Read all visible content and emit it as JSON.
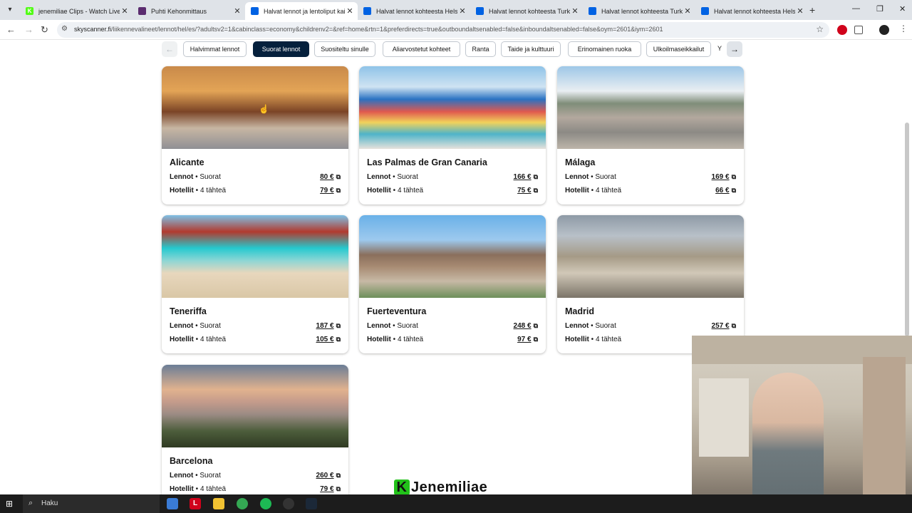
{
  "browser": {
    "tabs": [
      {
        "title": "jenemiliae Clips - Watch Live on",
        "fav_color": "#53fc18",
        "fav_text": "K"
      },
      {
        "title": "Puhti Kehonmittaus",
        "fav_color": "#5b2c6f",
        "fav_text": ""
      },
      {
        "title": "Halvat lennot ja lentoliput kaikk",
        "fav_color": "#0062e3",
        "fav_text": ""
      },
      {
        "title": "Halvat lennot kohteesta Helsinki",
        "fav_color": "#0062e3",
        "fav_text": ""
      },
      {
        "title": "Halvat lennot kohteesta Turku",
        "fav_color": "#0062e3",
        "fav_text": ""
      },
      {
        "title": "Halvat lennot kohteesta Turku",
        "fav_color": "#0062e3",
        "fav_text": ""
      },
      {
        "title": "Halvat lennot kohteesta Helsinki",
        "fav_color": "#0062e3",
        "fav_text": ""
      }
    ],
    "active_tab": 2,
    "url_domain": "skyscanner.fi",
    "url_path": "/liikennevalineet/lennot/hel/es/?adultsv2=1&cabinclass=economy&childrenv2=&ref=home&rtn=1&preferdirects=true&outboundaltsenabled=false&inboundaltsenabled=false&oym=2601&iym=2601"
  },
  "categories": {
    "items": [
      "Halvimmat lennot",
      "Suorat lennot",
      "Suositeltu sinulle",
      "Aliarvostetut kohteet",
      "Ranta",
      "Taide ja kulttuuri",
      "Erinomainen ruoka",
      "Ulkoilmaseikkailut",
      "Y"
    ],
    "selected": 1
  },
  "cards": [
    {
      "name": "Alicante",
      "flight_label": "Lennot",
      "flight_type": "Suorat",
      "flight_price": "80 €",
      "hotel_label": "Hotellit",
      "hotel_stars": "4 tähteä",
      "hotel_price": "79 €",
      "img": "alicante"
    },
    {
      "name": "Las Palmas de Gran Canaria",
      "flight_label": "Lennot",
      "flight_type": "Suorat",
      "flight_price": "166 €",
      "hotel_label": "Hotellit",
      "hotel_stars": "4 tähteä",
      "hotel_price": "75 €",
      "img": "laspalmas"
    },
    {
      "name": "Málaga",
      "flight_label": "Lennot",
      "flight_type": "Suorat",
      "flight_price": "169 €",
      "hotel_label": "Hotellit",
      "hotel_stars": "4 tähteä",
      "hotel_price": "66 €",
      "img": "malaga"
    },
    {
      "name": "Teneriffa",
      "flight_label": "Lennot",
      "flight_type": "Suorat",
      "flight_price": "187 €",
      "hotel_label": "Hotellit",
      "hotel_stars": "4 tähteä",
      "hotel_price": "105 €",
      "img": "teneriffa"
    },
    {
      "name": "Fuerteventura",
      "flight_label": "Lennot",
      "flight_type": "Suorat",
      "flight_price": "248 €",
      "hotel_label": "Hotellit",
      "hotel_stars": "4 tähteä",
      "hotel_price": "97 €",
      "img": "fuerte"
    },
    {
      "name": "Madrid",
      "flight_label": "Lennot",
      "flight_type": "Suorat",
      "flight_price": "257 €",
      "hotel_label": "Hotellit",
      "hotel_stars": "4 tähteä",
      "hotel_price": "",
      "img": "madrid"
    },
    {
      "name": "Barcelona",
      "flight_label": "Lennot",
      "flight_type": "Suorat",
      "flight_price": "260 €",
      "hotel_label": "Hotellit",
      "hotel_stars": "4 tähteä",
      "hotel_price": "79 €",
      "img": "barcelona"
    }
  ],
  "watermark": {
    "logo_letter": "K",
    "text": "Jenemiliae"
  },
  "taskbar": {
    "search_label": "Haku"
  },
  "icons": {
    "external": "external-link-icon"
  }
}
